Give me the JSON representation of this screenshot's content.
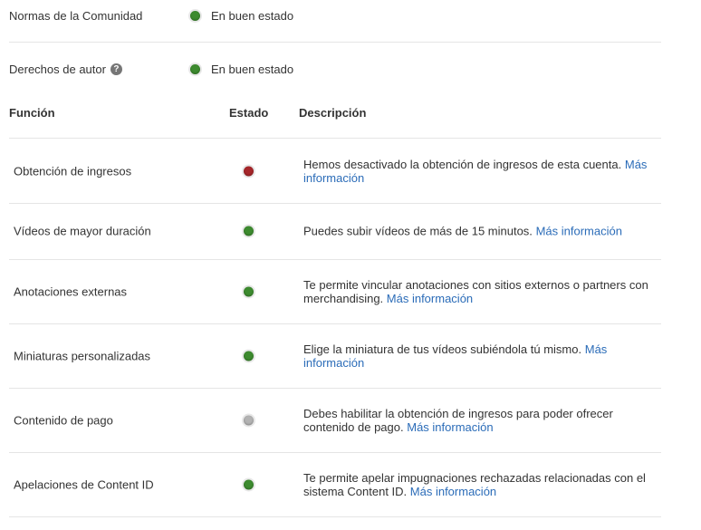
{
  "standing": [
    {
      "label": "Normas de la Comunidad",
      "status_text": "En buen estado",
      "status_color": "green",
      "has_help": false
    },
    {
      "label": "Derechos de autor",
      "status_text": "En buen estado",
      "status_color": "green",
      "has_help": true
    }
  ],
  "table": {
    "headers": {
      "function": "Función",
      "status": "Estado",
      "description": "Descripción"
    },
    "more_info_label": "Más información",
    "rows": [
      {
        "name": "Obtención de ingresos",
        "status": "red",
        "description": "Hemos desactivado la obtención de ingresos de esta cuenta."
      },
      {
        "name": "Vídeos de mayor duración",
        "status": "green",
        "description": "Puedes subir vídeos de más de 15 minutos."
      },
      {
        "name": "Anotaciones externas",
        "status": "green",
        "description": "Te permite vincular anotaciones con sitios externos o partners con merchandising."
      },
      {
        "name": "Miniaturas personalizadas",
        "status": "green",
        "description": "Elige la miniatura de tus vídeos subiéndola tú mismo."
      },
      {
        "name": "Contenido de pago",
        "status": "grey",
        "description": "Debes habilitar la obtención de ingresos para poder ofrecer contenido de pago."
      },
      {
        "name": "Apelaciones de Content ID",
        "status": "green",
        "description": "Te permite apelar impugnaciones rechazadas relacionadas con el sistema Content ID."
      }
    ]
  },
  "colors": {
    "green": "#3d8b2f",
    "red": "#a6262a",
    "grey": "#b3b3b3",
    "link": "#2b6cb8"
  },
  "icons": {
    "help": "question-circle-icon",
    "status": "status-dot-icon"
  }
}
